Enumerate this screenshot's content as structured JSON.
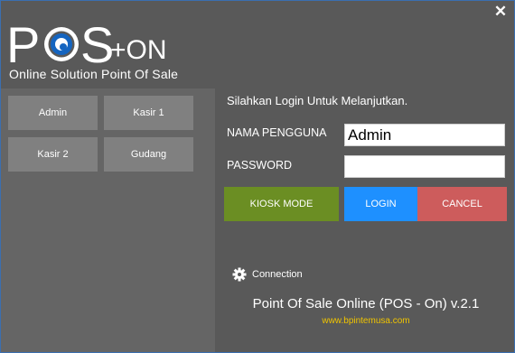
{
  "window": {
    "close_label": "✕"
  },
  "logo": {
    "letters_p": "P",
    "letters_s": "S",
    "suffix": "+ON",
    "tagline": "Online Solution Point Of Sale"
  },
  "users": [
    "Admin",
    "Kasir 1",
    "Kasir 2",
    "Gudang"
  ],
  "login": {
    "prompt": "Silahkan Login Untuk Melanjutkan.",
    "username_label": "NAMA PENGGUNA",
    "username_value": "Admin",
    "password_label": "PASSWORD",
    "password_value": ""
  },
  "buttons": {
    "kiosk": "KIOSK MODE",
    "login": "LOGIN",
    "cancel": "CANCEL"
  },
  "footer": {
    "connection": "Connection",
    "product": "Point Of Sale Online (POS - On) v.2.1",
    "website": "www.bpintemusa.com"
  },
  "colors": {
    "kiosk": "#6b8e23",
    "login": "#1e90ff",
    "cancel": "#cd5c5c",
    "logo_accent": "#1565c0",
    "website": "#f0c400"
  }
}
